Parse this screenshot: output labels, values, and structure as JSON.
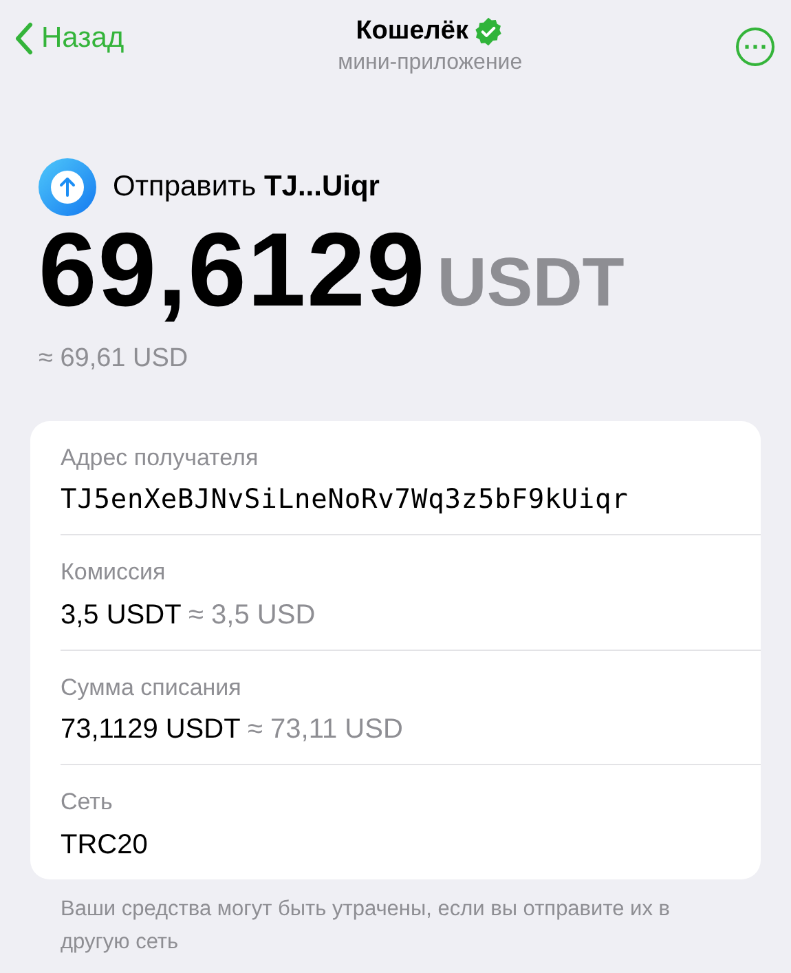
{
  "header": {
    "back": "Назад",
    "title": "Кошелёк",
    "verified": true,
    "subtitle": "мини-приложение",
    "menu": "⋯"
  },
  "send": {
    "title": "Отправить **TJ...Uiqr**"
  },
  "amount": {
    "value": "69,6129",
    "currency": "USDT",
    "approx": "≈ 69,61 USD"
  },
  "fields": [
    {
      "kind": "address",
      "label": "Адрес получателя",
      "value": "TJ5enXeBJNvSiLneNoRv7Wq3z5bF9kUiqr"
    },
    {
      "kind": "amount",
      "label": "Комиссия",
      "value": "3,5 USDT",
      "approx": "≈ 3,5 USD"
    },
    {
      "kind": "amount",
      "label": "Сумма списания",
      "value": "73,1129 USDT",
      "approx": "≈ 73,11 USD"
    },
    {
      "kind": "plain",
      "label": "Сеть",
      "value": "TRC20"
    }
  ],
  "footer": "Ваши средства могут быть утрачены, если вы отправите их в другую сеть"
}
